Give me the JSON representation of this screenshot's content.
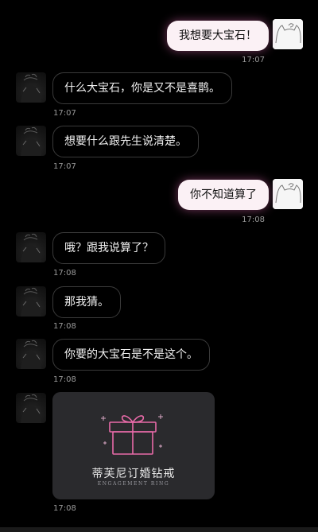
{
  "messages": [
    {
      "sender": "me",
      "text": "我想要大宝石！",
      "time": "17:07"
    },
    {
      "sender": "other",
      "text": "什么大宝石，你是又不是喜鹊。",
      "time": "17:07"
    },
    {
      "sender": "other",
      "text": "想要什么跟先生说清楚。",
      "time": "17:07"
    },
    {
      "sender": "me",
      "text": "你不知道算了",
      "time": "17:08"
    },
    {
      "sender": "other",
      "text": "哦？跟我说算了？",
      "time": "17:08"
    },
    {
      "sender": "other",
      "text": "那我猜。",
      "time": "17:08"
    },
    {
      "sender": "other",
      "text": "你要的大宝石是不是这个。",
      "time": "17:08"
    }
  ],
  "gift_card": {
    "title": "蒂芙尼订婚钻戒",
    "subtitle": "ENGAGEMENT RING",
    "time": "17:08",
    "icon": "gift-box-icon"
  },
  "colors": {
    "background": "#000000",
    "outgoing_bubble": "#fbf1f5",
    "outgoing_glow": "#ff78c8",
    "incoming_border": "#3a3a3a",
    "gift_card_bg": "#2a2a2d",
    "gift_icon_stroke": "#e86aa8"
  }
}
